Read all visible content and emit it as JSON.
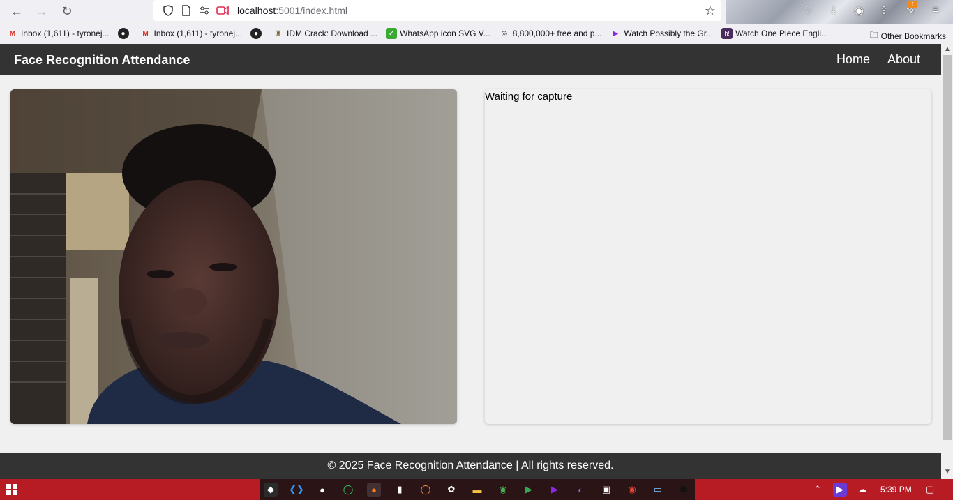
{
  "browser": {
    "url_host": "localhost",
    "url_path": ":5001/index.html",
    "bookmarks": [
      {
        "label": "Inbox (1,611) - tyronej...",
        "icon": "gmail-icon"
      },
      {
        "label": "",
        "icon": "obs-icon"
      },
      {
        "label": "Inbox (1,611) - tyronej...",
        "icon": "gmail-icon"
      },
      {
        "label": "",
        "icon": "obs-icon"
      },
      {
        "label": "IDM Crack: Download ...",
        "icon": "idm-icon"
      },
      {
        "label": "WhatsApp icon SVG V...",
        "icon": "whatsapp-icon"
      },
      {
        "label": "8,800,000+ free and p...",
        "icon": "pixabay-icon"
      },
      {
        "label": "Watch Possibly the Gr...",
        "icon": "play-icon"
      },
      {
        "label": "Watch One Piece Engli...",
        "icon": "hianime-icon"
      }
    ],
    "other_bookmarks": "Other Bookmarks",
    "extension_badge": "1"
  },
  "site": {
    "title": "Face Recognition Attendance",
    "nav": {
      "home": "Home",
      "about": "About"
    },
    "status": "Waiting for capture",
    "footer": "© 2025 Face Recognition Attendance | All rights reserved."
  },
  "taskbar": {
    "time": "5:39 PM"
  },
  "colors": {
    "header_bg": "#333333",
    "page_bg": "#f0f0f0",
    "taskbar_bg": "#b71c25"
  }
}
